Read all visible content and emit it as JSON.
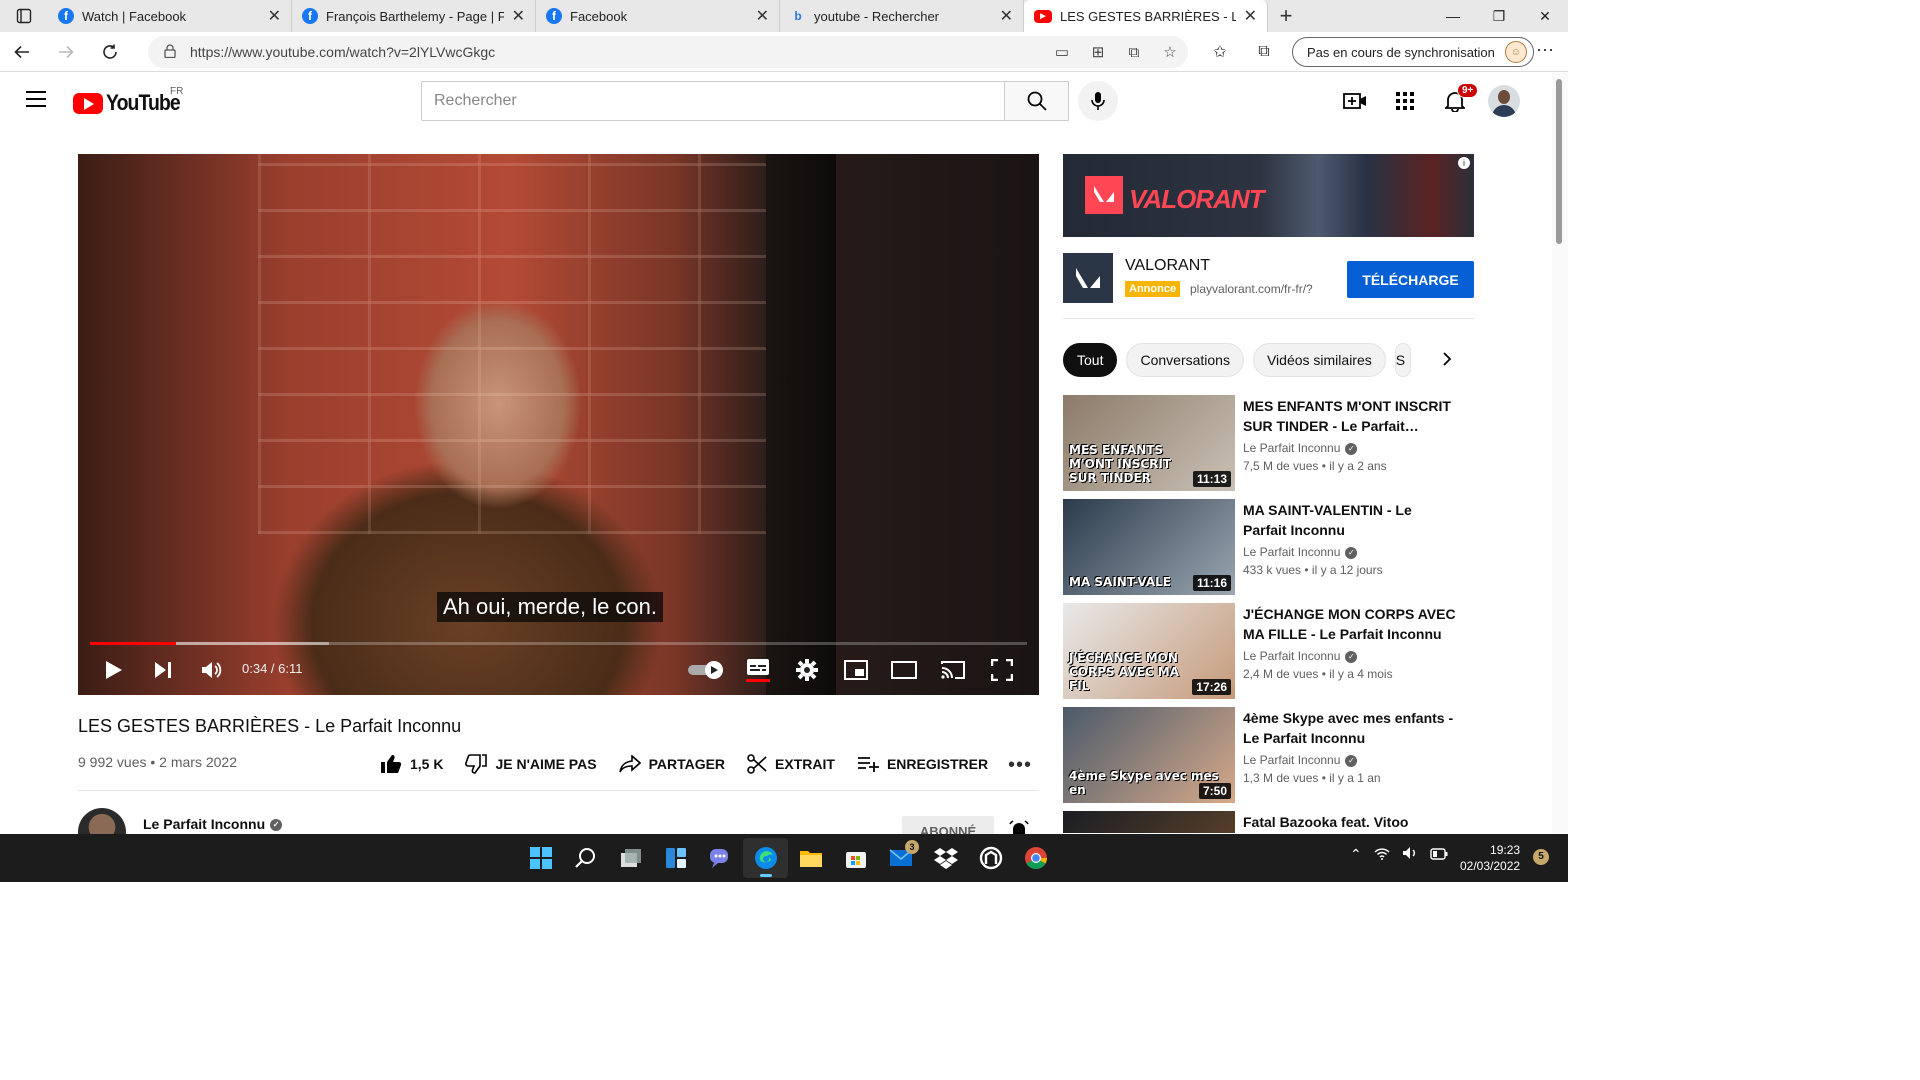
{
  "browser": {
    "tabs": [
      {
        "title": "Watch | Facebook",
        "favicon": "facebook-icon"
      },
      {
        "title": "François Barthelemy - Page | Facebook",
        "favicon": "facebook-icon"
      },
      {
        "title": "Facebook",
        "favicon": "facebook-icon"
      },
      {
        "title": "youtube - Rechercher",
        "favicon": "bing-icon"
      },
      {
        "title": "LES GESTES BARRIÈRES - Le Parfait Inconnu",
        "favicon": "youtube-icon",
        "active": true
      }
    ],
    "url": "https://www.youtube.com/watch?v=2lYLVwcGkgc",
    "sync_label": "Pas en cours de synchronisation"
  },
  "youtube": {
    "logo_text": "YouTube",
    "country_code": "FR",
    "search_placeholder": "Rechercher",
    "notification_count": "9+"
  },
  "player": {
    "subtitle": "Ah oui, merde, le con.",
    "time_display": "0:34 / 6:11",
    "played_fraction": 0.0921,
    "buffered_fraction": 0.255
  },
  "video": {
    "title": "LES GESTES BARRIÈRES - Le Parfait Inconnu",
    "meta": "9 992 vues • 2 mars 2022",
    "actions": {
      "like": "1,5 K",
      "dislike": "JE N'AIME PAS",
      "share": "PARTAGER",
      "clip": "EXTRAIT",
      "save": "ENREGISTRER"
    },
    "channel": "Le Parfait Inconnu",
    "subscribe_label": "ABONNÉ"
  },
  "ad": {
    "banner_brand": "VALORANT",
    "name": "VALORANT",
    "tag": "Annonce",
    "url": "playvalorant.com/fr-fr/?",
    "cta": "TÉLÉCHARGE"
  },
  "chips": [
    "Tout",
    "Conversations",
    "Vidéos similaires",
    "S"
  ],
  "recommendations": [
    {
      "title": "MES ENFANTS M'ONT INSCRIT SUR TINDER - Le Parfait…",
      "channel": "Le Parfait Inconnu",
      "meta": "7,5 M de vues • il y a 2 ans",
      "duration": "11:13",
      "thumb_text": "MES ENFANTS M'ONT INSCRIT SUR TINDER",
      "color1": "#8d7b6a",
      "color2": "#c9c1b5"
    },
    {
      "title": "MA SAINT-VALENTIN - Le Parfait Inconnu",
      "channel": "Le Parfait Inconnu",
      "meta": "433 k vues • il y a 12 jours",
      "duration": "11:16",
      "thumb_text": "MA SAINT-VALE",
      "color1": "#2c3b4c",
      "color2": "#9aa7b2"
    },
    {
      "title": "J'ÉCHANGE MON CORPS AVEC MA FILLE - Le Parfait Inconnu",
      "channel": "Le Parfait Inconnu",
      "meta": "2,4 M de vues • il y a 4 mois",
      "duration": "17:26",
      "thumb_text": "J'ÉCHANGE MON CORPS AVEC MA FIL",
      "color1": "#e9e9e9",
      "color2": "#c59a7a"
    },
    {
      "title": "4ème Skype avec mes enfants - Le Parfait Inconnu",
      "channel": "Le Parfait Inconnu",
      "meta": "1,3 M de vues • il y a 1 an",
      "duration": "7:50",
      "thumb_text": "4ème Skype avec mes en",
      "color1": "#4a5a6a",
      "color2": "#d6a989"
    },
    {
      "title": "Fatal Bazooka feat. Vitoo",
      "channel": "",
      "meta": "",
      "duration": "",
      "thumb_text": "",
      "color1": "#1b1e24",
      "color2": "#6b4a2a"
    }
  ],
  "taskbar": {
    "mail_badge": "3",
    "time": "19:23",
    "date": "02/03/2022",
    "notification_count": "5"
  }
}
